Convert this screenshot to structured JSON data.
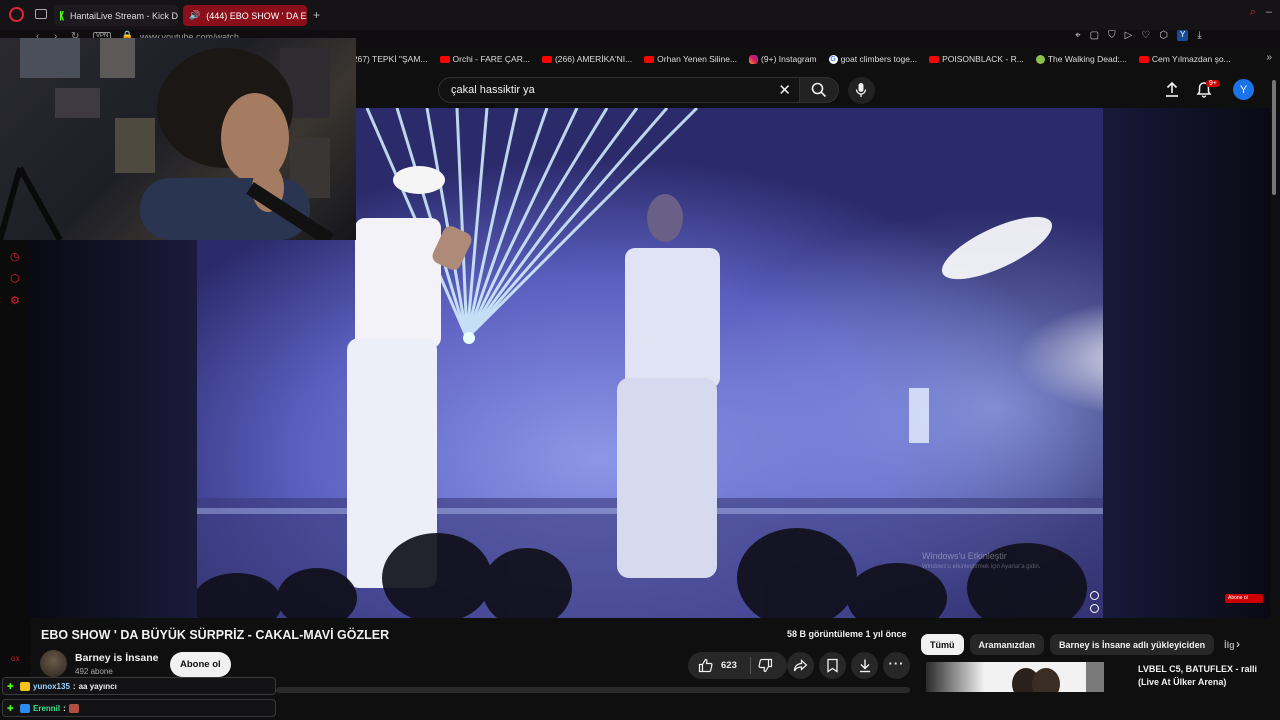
{
  "browser": {
    "tabs": [
      {
        "label": "HantaiLive Stream - Kick D"
      },
      {
        "label": "(444) EBO SHOW ' DA E"
      }
    ],
    "url": "www.youtube.com/watch",
    "vpn_label": "VPN",
    "ext_profile": "Y",
    "bookmarks": [
      {
        "label": "(267) TEPKİ \"ŞAM...",
        "icon": "none"
      },
      {
        "label": "Orchi - FARE ÇAR...",
        "icon": "youtube"
      },
      {
        "label": "(266) AMERİKA'NI...",
        "icon": "youtube"
      },
      {
        "label": "Orhan Yenen Siline...",
        "icon": "youtube"
      },
      {
        "label": "(9+) Instagram",
        "icon": "instagram"
      },
      {
        "label": "goat climbers toge...",
        "icon": "google"
      },
      {
        "label": "POISONBLACK - R...",
        "icon": "youtube"
      },
      {
        "label": "The Walking Dead:...",
        "icon": "walkingdead"
      },
      {
        "label": "Cem Yılmazdan şo...",
        "icon": "youtube"
      }
    ]
  },
  "youtube": {
    "search": {
      "value": "çakal hassiktir ya"
    },
    "notifications_badge": "9+",
    "avatar_letter": "Y",
    "video": {
      "watermark_line1": "Windows'u Etkinleştir",
      "watermark_line2": "Windows'u etkinleştirmek için Ayarlar'a gidin.",
      "subscribe_badge": "Abone ol"
    },
    "title": "EBO SHOW ' DA BÜYÜK SÜRPRİZ - CAKAL-MAVİ GÖZLER",
    "views": "58 B görüntüleme  1 yıl önce",
    "channel": {
      "name": "Barney is İnsane",
      "subs": "492 abone",
      "subscribe_label": "Abone ol"
    },
    "actions": {
      "likes": "623"
    },
    "chips": [
      {
        "label": "Tümü",
        "active": true
      },
      {
        "label": "Aramanızdan",
        "active": false
      },
      {
        "label": "Barney is İnsane adlı yükleyiciden",
        "active": false
      },
      {
        "label": "İlg",
        "active": false
      }
    ],
    "recommendation": {
      "title": "LVBEL C5, BATUFLEX - ralli (Live At Ülker Arena)"
    }
  },
  "chat": [
    {
      "user": "yunox135",
      "message": "aa yayıncı"
    },
    {
      "user": "Erennil",
      "message": ""
    }
  ],
  "gx_label": "GX",
  "colors": {
    "accent": "#e0243a",
    "youtube_red": "#ff0000",
    "background": "#0f0f0f"
  }
}
